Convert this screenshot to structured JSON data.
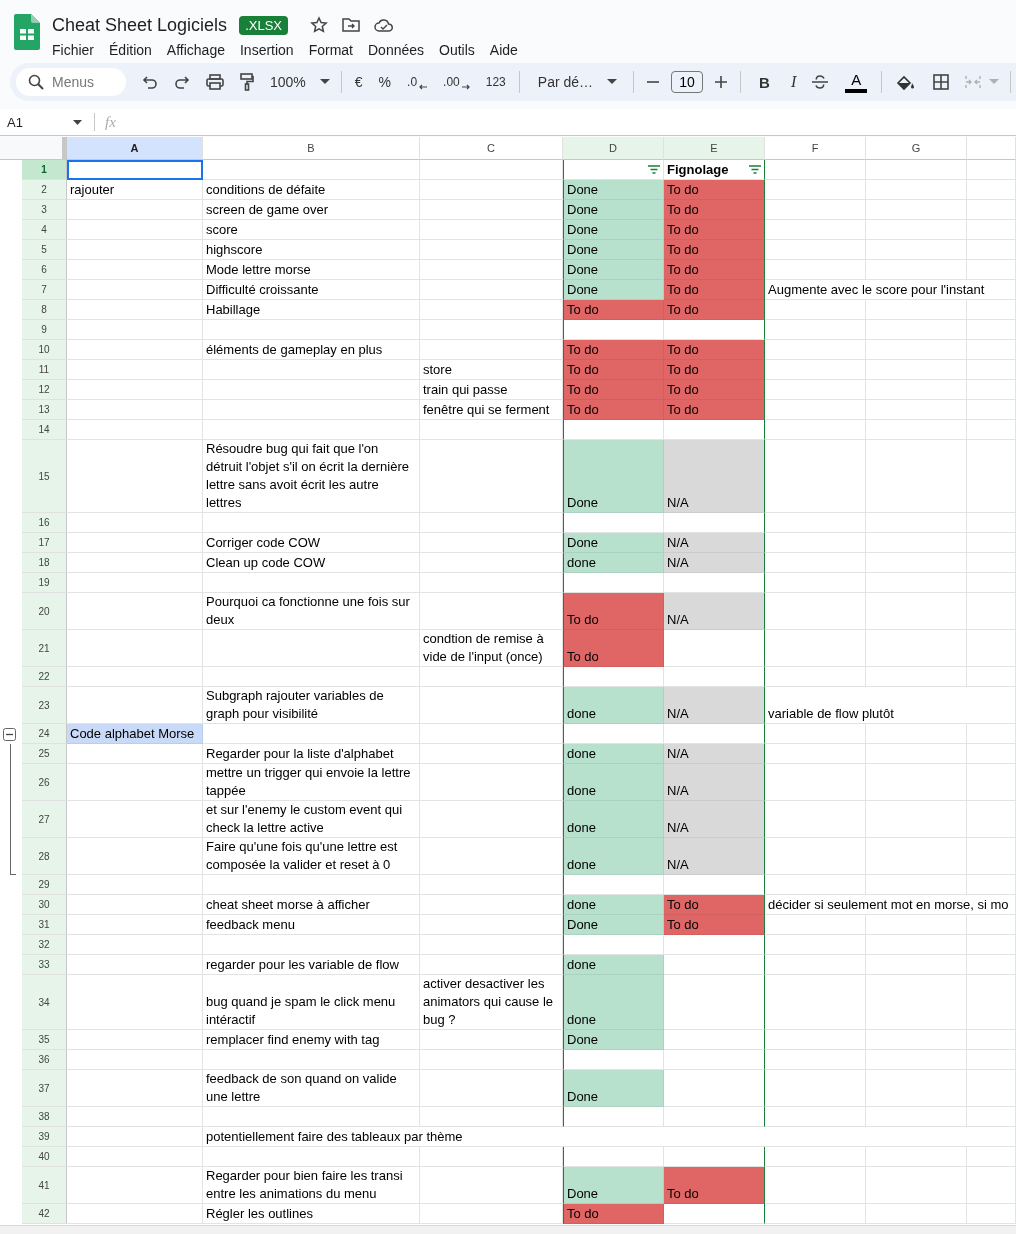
{
  "title": "Cheat Sheet Logiciels",
  "file_badge": ".XLSX",
  "menu": [
    "Fichier",
    "Édition",
    "Affichage",
    "Insertion",
    "Format",
    "Données",
    "Outils",
    "Aide"
  ],
  "toolbar": {
    "search_placeholder": "Menus",
    "zoom": "100%",
    "currency": "€",
    "percent": "%",
    "decrease_decimals": ".0",
    "increase_decimals": ".00",
    "number_format": "123",
    "font": "Par dé…",
    "font_size": "10",
    "bold": "B",
    "italic": "I",
    "text_color": "A"
  },
  "formula_bar": {
    "name_box": "A1",
    "fx": "fx"
  },
  "columns": [
    {
      "label": "A",
      "selected": true,
      "filtered": false
    },
    {
      "label": "B",
      "selected": false,
      "filtered": false
    },
    {
      "label": "C",
      "selected": false,
      "filtered": false
    },
    {
      "label": "D",
      "selected": false,
      "filtered": true
    },
    {
      "label": "E",
      "selected": false,
      "filtered": true
    },
    {
      "label": "F",
      "selected": false,
      "filtered": false
    },
    {
      "label": "G",
      "selected": false,
      "filtered": false
    }
  ],
  "rows": [
    {
      "header": "1",
      "selected": true,
      "a": {
        "selected": true
      },
      "d": {
        "filter": true
      },
      "e": {
        "text": "Fignolage",
        "bold": true,
        "filter": true
      }
    },
    {
      "header": "2",
      "selected": false,
      "a": {
        "text": "rajouter"
      },
      "b": {
        "text": "conditions de défaite"
      },
      "d": {
        "text": "Done",
        "color": "#b7e1cd"
      },
      "e": {
        "text": "To do",
        "color": "#e06666"
      }
    },
    {
      "header": "3",
      "selected": false,
      "b": {
        "text": "screen de game over"
      },
      "d": {
        "text": "Done",
        "color": "#b7e1cd"
      },
      "e": {
        "text": "To do",
        "color": "#e06666"
      }
    },
    {
      "header": "4",
      "selected": false,
      "b": {
        "text": "score"
      },
      "d": {
        "text": "Done",
        "color": "#b7e1cd"
      },
      "e": {
        "text": "To do",
        "color": "#e06666"
      }
    },
    {
      "header": "5",
      "selected": false,
      "b": {
        "text": "highscore"
      },
      "d": {
        "text": "Done",
        "color": "#b7e1cd"
      },
      "e": {
        "text": "To do",
        "color": "#e06666"
      }
    },
    {
      "header": "6",
      "selected": false,
      "b": {
        "text": "Mode lettre morse"
      },
      "d": {
        "text": "Done",
        "color": "#b7e1cd"
      },
      "e": {
        "text": "To do",
        "color": "#e06666"
      }
    },
    {
      "header": "7",
      "selected": false,
      "b": {
        "text": "Difficulté croissante"
      },
      "d": {
        "text": "Done",
        "color": "#b7e1cd"
      },
      "e": {
        "text": "To do",
        "color": "#e06666"
      },
      "f": {
        "text": "Augmente avec le score pour l'instant",
        "overflow": true
      }
    },
    {
      "header": "8",
      "selected": false,
      "b": {
        "text": "Habillage"
      },
      "d": {
        "text": "To do",
        "color": "#e06666"
      },
      "e": {
        "text": "To do",
        "color": "#e06666"
      }
    },
    {
      "header": "9",
      "selected": false
    },
    {
      "header": "10",
      "selected": false,
      "b": {
        "text": "éléments de gameplay en plus"
      },
      "d": {
        "text": "To do",
        "color": "#e06666"
      },
      "e": {
        "text": "To do",
        "color": "#e06666"
      }
    },
    {
      "header": "11",
      "selected": false,
      "c": {
        "text": "store"
      },
      "d": {
        "text": "To do",
        "color": "#e06666"
      },
      "e": {
        "text": "To do",
        "color": "#e06666"
      }
    },
    {
      "header": "12",
      "selected": false,
      "c": {
        "text": "train qui passe"
      },
      "d": {
        "text": "To do",
        "color": "#e06666"
      },
      "e": {
        "text": "To do",
        "color": "#e06666"
      }
    },
    {
      "header": "13",
      "selected": false,
      "c": {
        "text": "fenêtre qui se ferment"
      },
      "d": {
        "text": "To do",
        "color": "#e06666"
      },
      "e": {
        "text": "To do",
        "color": "#e06666"
      }
    },
    {
      "header": "14",
      "selected": false
    },
    {
      "header": "15",
      "selected": false,
      "b": {
        "text": "Résoudre bug qui fait que l'on détruit l'objet s'il on écrit la dernière lettre sans avoit écrit les autre lettres"
      },
      "d": {
        "text": "Done",
        "color": "#b7e1cd"
      },
      "e": {
        "text": "N/A",
        "color": "#d9d9d9"
      }
    },
    {
      "header": "16",
      "selected": false
    },
    {
      "header": "17",
      "selected": false,
      "b": {
        "text": "Corriger code COW"
      },
      "d": {
        "text": "Done",
        "color": "#b7e1cd"
      },
      "e": {
        "text": "N/A",
        "color": "#d9d9d9"
      }
    },
    {
      "header": "18",
      "selected": false,
      "b": {
        "text": "Clean up code COW"
      },
      "d": {
        "text": "done",
        "color": "#b7e1cd"
      },
      "e": {
        "text": "N/A",
        "color": "#d9d9d9"
      }
    },
    {
      "header": "19",
      "selected": false
    },
    {
      "header": "20",
      "selected": false,
      "b": {
        "text": "Pourquoi ca fonctionne une fois sur deux"
      },
      "d": {
        "text": "To do",
        "color": "#e06666"
      },
      "e": {
        "text": "N/A",
        "color": "#d9d9d9"
      }
    },
    {
      "header": "21",
      "selected": false,
      "c": {
        "text": "condtion de remise à vide de l'input (once)"
      },
      "d": {
        "text": "To do",
        "color": "#e06666"
      }
    },
    {
      "header": "22",
      "selected": false
    },
    {
      "header": "23",
      "selected": false,
      "b": {
        "text": "Subgraph rajouter variables de graph pour visibilité"
      },
      "d": {
        "text": "done",
        "color": "#b7e1cd"
      },
      "e": {
        "text": "N/A",
        "color": "#d9d9d9"
      },
      "f": {
        "text": "variable de flow plutôt",
        "overflow": true
      }
    },
    {
      "header": "24",
      "selected": false,
      "group_toggle": {
        "expanded": true
      },
      "a": {
        "text": "Code alphabet Morse",
        "color": "#c9daf8"
      }
    },
    {
      "header": "25",
      "selected": false,
      "grouped": true,
      "b": {
        "text": "Regarder pour la liste d'alphabet"
      },
      "d": {
        "text": "done",
        "color": "#b7e1cd"
      },
      "e": {
        "text": "N/A",
        "color": "#d9d9d9"
      }
    },
    {
      "header": "26",
      "selected": false,
      "grouped": true,
      "b": {
        "text": "mettre un trigger qui envoie la lettre tappée"
      },
      "d": {
        "text": "done",
        "color": "#b7e1cd"
      },
      "e": {
        "text": "N/A",
        "color": "#d9d9d9"
      }
    },
    {
      "header": "27",
      "selected": false,
      "grouped": true,
      "b": {
        "text": "et sur l'enemy le custom event qui check la lettre active"
      },
      "d": {
        "text": "done",
        "color": "#b7e1cd"
      },
      "e": {
        "text": "N/A",
        "color": "#d9d9d9"
      }
    },
    {
      "header": "28",
      "selected": false,
      "grouped": true,
      "b": {
        "text": "Faire qu'une fois qu'une lettre est composée la valider et reset à 0"
      },
      "d": {
        "text": "done",
        "color": "#b7e1cd"
      },
      "e": {
        "text": "N/A",
        "color": "#d9d9d9"
      }
    },
    {
      "header": "29",
      "selected": false
    },
    {
      "header": "30",
      "selected": false,
      "b": {
        "text": "cheat sheet morse à afficher"
      },
      "d": {
        "text": "done",
        "color": "#b7e1cd"
      },
      "e": {
        "text": "To do",
        "color": "#e06666"
      },
      "f": {
        "text": "décider si seulement mot en morse, si mo",
        "overflow": true
      }
    },
    {
      "header": "31",
      "selected": false,
      "b": {
        "text": "feedback menu"
      },
      "d": {
        "text": "Done",
        "color": "#b7e1cd"
      },
      "e": {
        "text": "To do",
        "color": "#e06666"
      }
    },
    {
      "header": "32",
      "selected": false
    },
    {
      "header": "33",
      "selected": false,
      "b": {
        "text": "regarder pour les variable de flow"
      },
      "d": {
        "text": "done",
        "color": "#b7e1cd"
      }
    },
    {
      "header": "34",
      "selected": false,
      "b": {
        "text": "bug quand je spam le click menu intéractif"
      },
      "c": {
        "text": "activer desactiver les animators qui cause le bug ?"
      },
      "d": {
        "text": "done",
        "color": "#b7e1cd"
      }
    },
    {
      "header": "35",
      "selected": false,
      "b": {
        "text": "remplacer find enemy with tag"
      },
      "d": {
        "text": "Done",
        "color": "#b7e1cd"
      }
    },
    {
      "header": "36",
      "selected": false
    },
    {
      "header": "37",
      "selected": false,
      "b": {
        "text": "feedback de son quand on valide une lettre"
      },
      "d": {
        "text": "Done",
        "color": "#b7e1cd"
      }
    },
    {
      "header": "38",
      "selected": false
    },
    {
      "header": "39",
      "selected": false,
      "b": {
        "text": "potentiellement faire des tableaux par thème",
        "overflow": true
      }
    },
    {
      "header": "40",
      "selected": false
    },
    {
      "header": "41",
      "selected": false,
      "b": {
        "text": "Regarder pour bien faire les transi entre les animations du menu"
      },
      "d": {
        "text": "Done",
        "color": "#b7e1cd"
      },
      "e": {
        "text": "To do",
        "color": "#e06666"
      }
    },
    {
      "header": "42",
      "selected": false,
      "b": {
        "text": "Régler les outlines"
      },
      "d": {
        "text": "To do",
        "color": "#e06666"
      }
    }
  ]
}
